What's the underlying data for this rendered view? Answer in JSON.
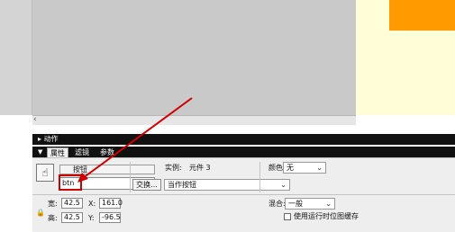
{
  "actions_panel": {
    "title": "动作"
  },
  "properties_panel": {
    "tabs": [
      {
        "label": "属性",
        "active": true
      },
      {
        "label": "滤镜",
        "active": false
      },
      {
        "label": "参数",
        "active": false
      }
    ],
    "symbol_type": "按钮",
    "instance_name": "btn",
    "instance_label": "实例:",
    "instance_of": "元件 3",
    "swap_button": "交换...",
    "track_as": "当作按钮",
    "color_label": "颜色:",
    "color_value": "无",
    "width_label": "宽:",
    "width_value": "42.5",
    "height_label": "高:",
    "height_value": "42.5",
    "x_label": "X:",
    "x_value": "161.0",
    "y_label": "Y:",
    "y_value": "-96.5",
    "blend_label": "混合:",
    "blend_value": "一般",
    "cache_label": "使用运行时位图缓存",
    "cache_checked": false
  },
  "colors": {
    "canvas": "#fffed8",
    "accent_shape": "#ff9a00",
    "annotation": "#d00000",
    "panel_header": "#111111"
  },
  "icons": [
    "scroll-left-icon",
    "collapse-triangle-icon",
    "button-symbol-icon",
    "lock-icon",
    "dropdown-arrow-icon",
    "annotation-arrow-icon"
  ]
}
